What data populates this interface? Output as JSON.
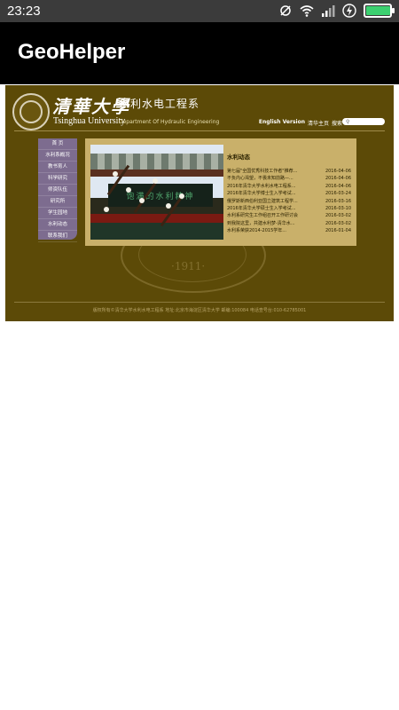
{
  "status_bar": {
    "time": "23:23",
    "icons": [
      "mute-icon",
      "wifi-icon",
      "signal-icon",
      "charging-icon",
      "battery-icon"
    ],
    "battery_level": 0.95
  },
  "app_bar": {
    "title": "GeoHelper"
  },
  "web": {
    "logo": {
      "zh": "清華大學",
      "en": "Tsinghua University"
    },
    "dept": {
      "zh": "水利水电工程系",
      "en": "Department Of Hydraulic Engineering"
    },
    "top_links": [
      "English Version",
      "清华主页",
      "搜索"
    ],
    "nav": [
      "首 页",
      "水利系概况",
      "教书育人",
      "科学研究",
      "师资队伍",
      "研究所",
      "学生园地",
      "水利动态",
      "联系我们"
    ],
    "photo_sign": "饱满的水利精神",
    "news_title": "水利动态",
    "news": [
      {
        "title": "第七届\"全国优秀科技工作者\"推荐...",
        "date": "2016-04-06"
      },
      {
        "title": "不负内心渴望，不畏未知前路—...",
        "date": "2016-04-06"
      },
      {
        "title": "2016年清华大学水利水电工程系...",
        "date": "2016-04-06"
      },
      {
        "title": "2016年清华大学博士生入学考试...",
        "date": "2016-03-24"
      },
      {
        "title": "俄罗斯新西伯利亚国立建筑工程学...",
        "date": "2016-03-16"
      },
      {
        "title": "2016年清华大学硕士生入学考试...",
        "date": "2016-03-10"
      },
      {
        "title": "水利系研究生工作组召开工作研讨会",
        "date": "2016-03-02"
      },
      {
        "title": "到我院这里，共建水利梦-清华水...",
        "date": "2016-03-02"
      },
      {
        "title": "水利系荣获2014-2015学年...",
        "date": "2016-01-04"
      }
    ],
    "footer": "版权所有©清华大学水利水电工程系 地址:北京市海淀区清华大学 邮编:100084 电话查号台:010-62785001",
    "colors": {
      "page_bg": "#5c4a07",
      "panel_bg": "#c9b06a",
      "nav_bg": "#7d6c8f"
    }
  }
}
